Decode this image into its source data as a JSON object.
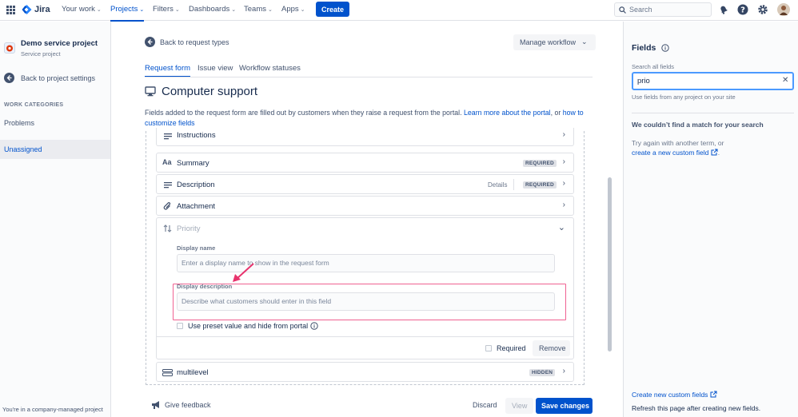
{
  "topnav": {
    "logo_text": "Jira",
    "items": [
      {
        "label": "Your work"
      },
      {
        "label": "Projects"
      },
      {
        "label": "Filters"
      },
      {
        "label": "Dashboards"
      },
      {
        "label": "Teams"
      },
      {
        "label": "Apps"
      }
    ],
    "create_label": "Create",
    "search_placeholder": "Search"
  },
  "sidebar": {
    "project_name": "Demo service project",
    "project_type": "Service project",
    "back_label": "Back to project settings",
    "section_heading": "WORK CATEGORIES",
    "items": [
      {
        "label": "Problems"
      },
      {
        "label": "Unassigned"
      }
    ],
    "footer": "You're in a company-managed project"
  },
  "main": {
    "back_link": "Back to request types",
    "manage_workflow": "Manage workflow",
    "tabs": [
      {
        "label": "Request form"
      },
      {
        "label": "Issue view"
      },
      {
        "label": "Workflow statuses"
      }
    ],
    "title": "Computer support",
    "description_text": "Fields added to the request form are filled out by customers when they raise a request from the portal.",
    "description_link1": "Learn more about the portal",
    "description_or": ", or",
    "description_link2": "how to customize fields",
    "fields": {
      "instructions": "Instructions",
      "summary": "Summary",
      "summary_badge": "REQUIRED",
      "description": "Description",
      "description_details": "Details",
      "description_badge": "REQUIRED",
      "attachment": "Attachment",
      "priority": "Priority",
      "multilevel": "multilevel",
      "multilevel_badge": "HIDDEN"
    },
    "priority_editor": {
      "display_name_label": "Display name",
      "display_name_placeholder": "Enter a display name to show in the request form",
      "display_description_label": "Display description",
      "display_description_placeholder": "Describe what customers should enter in this field",
      "preset_label": "Use preset value and hide from portal",
      "required_label": "Required",
      "remove_label": "Remove"
    },
    "footer": {
      "feedback": "Give feedback",
      "discard": "Discard",
      "view": "View",
      "save": "Save changes"
    }
  },
  "rightpanel": {
    "title": "Fields",
    "search_label": "Search all fields",
    "search_value": "prio",
    "search_helper": "Use fields from any project on your site",
    "no_match_heading": "We couldn’t find a match for your search",
    "no_match_text": "Try again with another term, or",
    "create_link": "create a new custom field",
    "create_footer_link": "Create new custom fields",
    "refresh_text": "Refresh this page after creating new fields."
  },
  "colors": {
    "brand": "#0052cc",
    "highlight_border": "#f06292",
    "arrow": "#e8336d"
  }
}
